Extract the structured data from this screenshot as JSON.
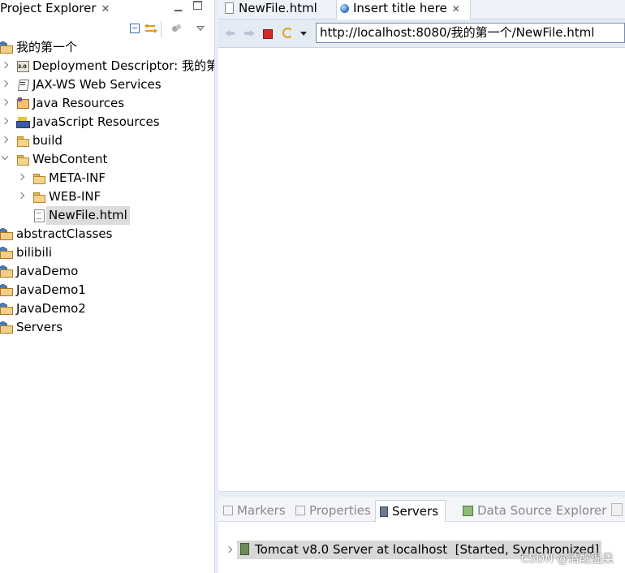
{
  "explorer": {
    "title": "Project Explorer",
    "close_glyph": "✕",
    "toolbar_icons": [
      "collapse-all-icon",
      "link-with-editor-icon",
      "filter-icon",
      "view-menu-icon"
    ],
    "tree": [
      {
        "label": "我的第一个",
        "icon": "project-icon",
        "expanded": true
      },
      {
        "label": "Deployment Descriptor: 我的第",
        "icon": "deployment-descriptor-icon"
      },
      {
        "label": "JAX-WS Web Services",
        "icon": "jaxws-icon"
      },
      {
        "label": "Java Resources",
        "icon": "java-resources-icon"
      },
      {
        "label": "JavaScript Resources",
        "icon": "javascript-resources-icon"
      },
      {
        "label": "build",
        "icon": "folder-icon"
      },
      {
        "label": "WebContent",
        "icon": "folder-icon",
        "expanded": true
      },
      {
        "label": "META-INF",
        "icon": "folder-icon"
      },
      {
        "label": "WEB-INF",
        "icon": "folder-icon"
      },
      {
        "label": "NewFile.html",
        "icon": "html-file-icon",
        "selected": true
      },
      {
        "label": "abstractClasses",
        "icon": "project-icon"
      },
      {
        "label": "bilibili",
        "icon": "project-icon"
      },
      {
        "label": "JavaDemo",
        "icon": "project-icon"
      },
      {
        "label": "JavaDemo1",
        "icon": "project-error-icon"
      },
      {
        "label": "JavaDemo2",
        "icon": "project-error-icon"
      },
      {
        "label": "Servers",
        "icon": "project-icon"
      }
    ]
  },
  "editor": {
    "tabs": [
      {
        "label": "NewFile.html",
        "active": false
      },
      {
        "label": "Insert title here",
        "active": true
      }
    ],
    "close_glyph": "✕",
    "url": "http://localhost:8080/我的第一个/NewFile.html"
  },
  "bottom": {
    "tabs": [
      {
        "label": "Markers",
        "active": false
      },
      {
        "label": "Properties",
        "active": false
      },
      {
        "label": "Servers",
        "active": true
      },
      {
        "label": "Data Source Explorer",
        "active": false
      }
    ],
    "server_entry": "Tomcat v8.0 Server at localhost  [Started, Synchronized]"
  },
  "watermark": "CSDN @清醒温柔"
}
